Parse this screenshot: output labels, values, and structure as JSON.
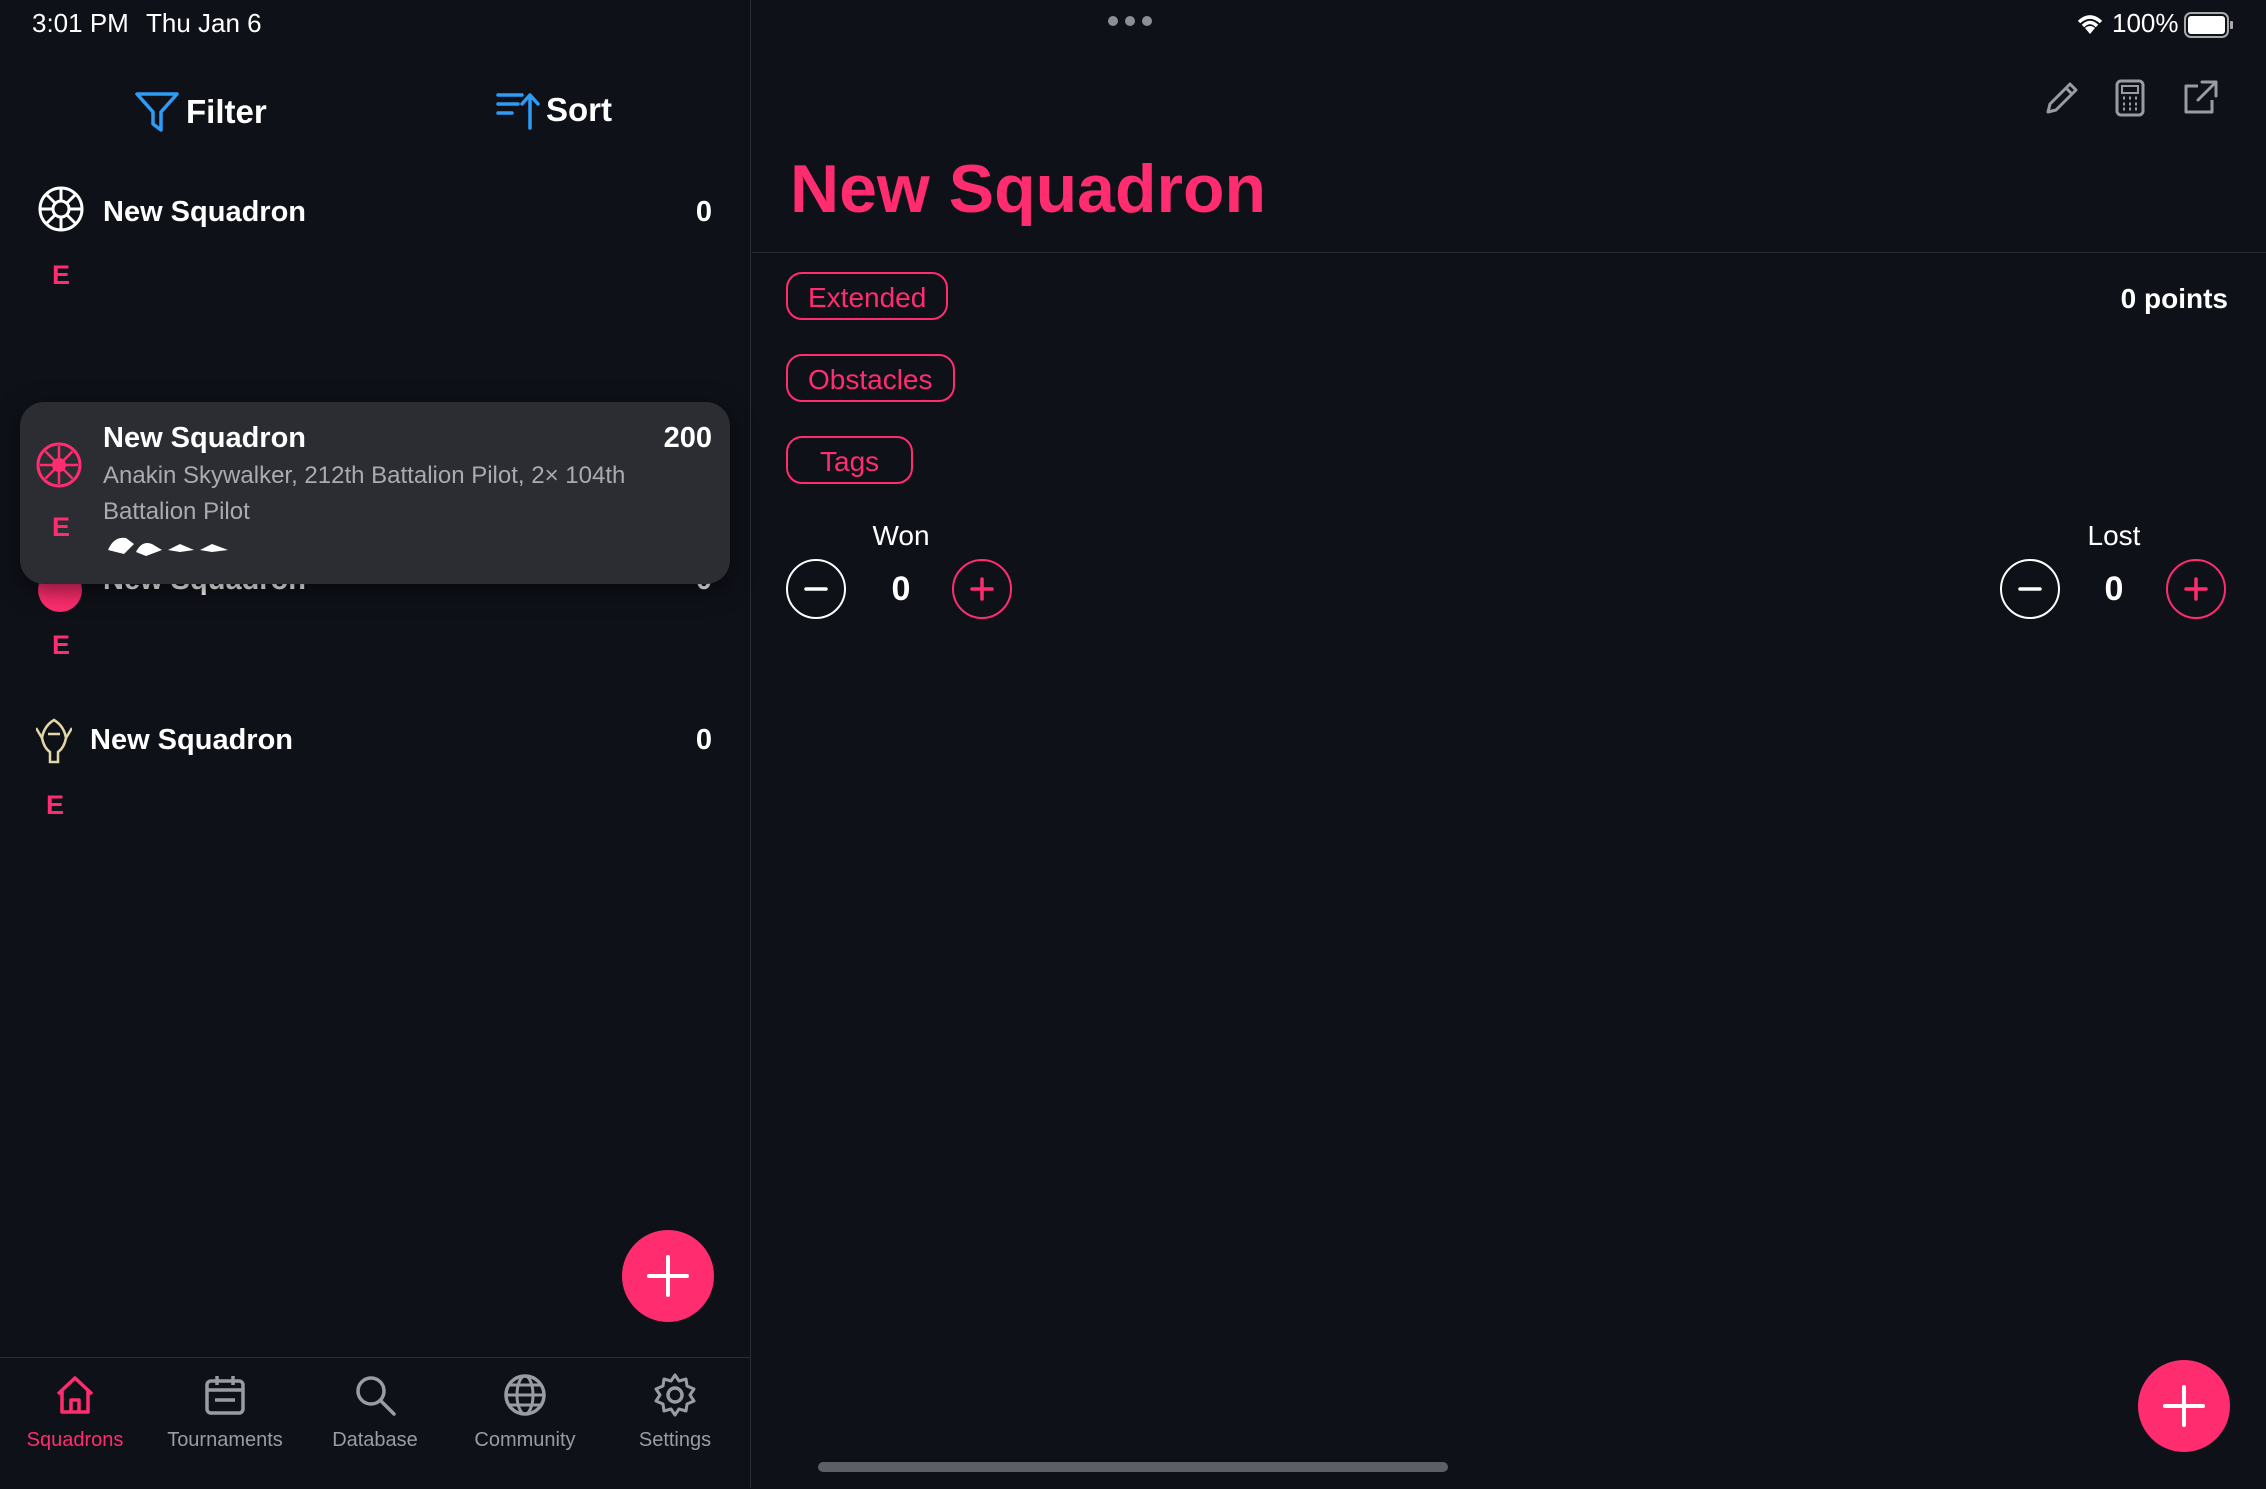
{
  "status_bar": {
    "time": "3:01 PM",
    "date": "Thu Jan 6",
    "battery": "100%"
  },
  "sidebar": {
    "filter_label": "Filter",
    "sort_label": "Sort",
    "squadrons": [
      {
        "name": "New Squadron",
        "points": "0",
        "format": "E",
        "faction_icon": "galactic-empire-icon"
      },
      {
        "name": "New Squadron",
        "points": "200",
        "format": "E",
        "faction_icon": "galactic-republic-icon",
        "pilots": "Anakin Skywalker, 212th Battalion Pilot, 2× 104th Battalion Pilot",
        "ships_icon": "ship-silhouettes-icon"
      },
      {
        "name": "New Squadron",
        "points": "0",
        "format": "E",
        "faction_icon": "faction-icon"
      },
      {
        "name": "New Squadron",
        "points": "0",
        "format": "E",
        "faction_icon": "mandalorian-icon"
      }
    ]
  },
  "tabbar": {
    "tabs": [
      {
        "label": "Squadrons",
        "icon": "home-icon",
        "active": true
      },
      {
        "label": "Tournaments",
        "icon": "calendar-icon",
        "active": false
      },
      {
        "label": "Database",
        "icon": "search-icon",
        "active": false
      },
      {
        "label": "Community",
        "icon": "globe-icon",
        "active": false
      },
      {
        "label": "Settings",
        "icon": "gear-icon",
        "active": false
      }
    ]
  },
  "detail": {
    "title": "New Squadron",
    "chips": {
      "format": "Extended",
      "obstacles": "Obstacles",
      "tags": "Tags"
    },
    "points": "0 points",
    "won": {
      "label": "Won",
      "value": "0"
    },
    "lost": {
      "label": "Lost",
      "value": "0"
    }
  },
  "colors": {
    "accent": "#ff2d6f",
    "background": "#0f1119",
    "popover": "#2b2d33",
    "link_blue": "#2e9cf5"
  }
}
